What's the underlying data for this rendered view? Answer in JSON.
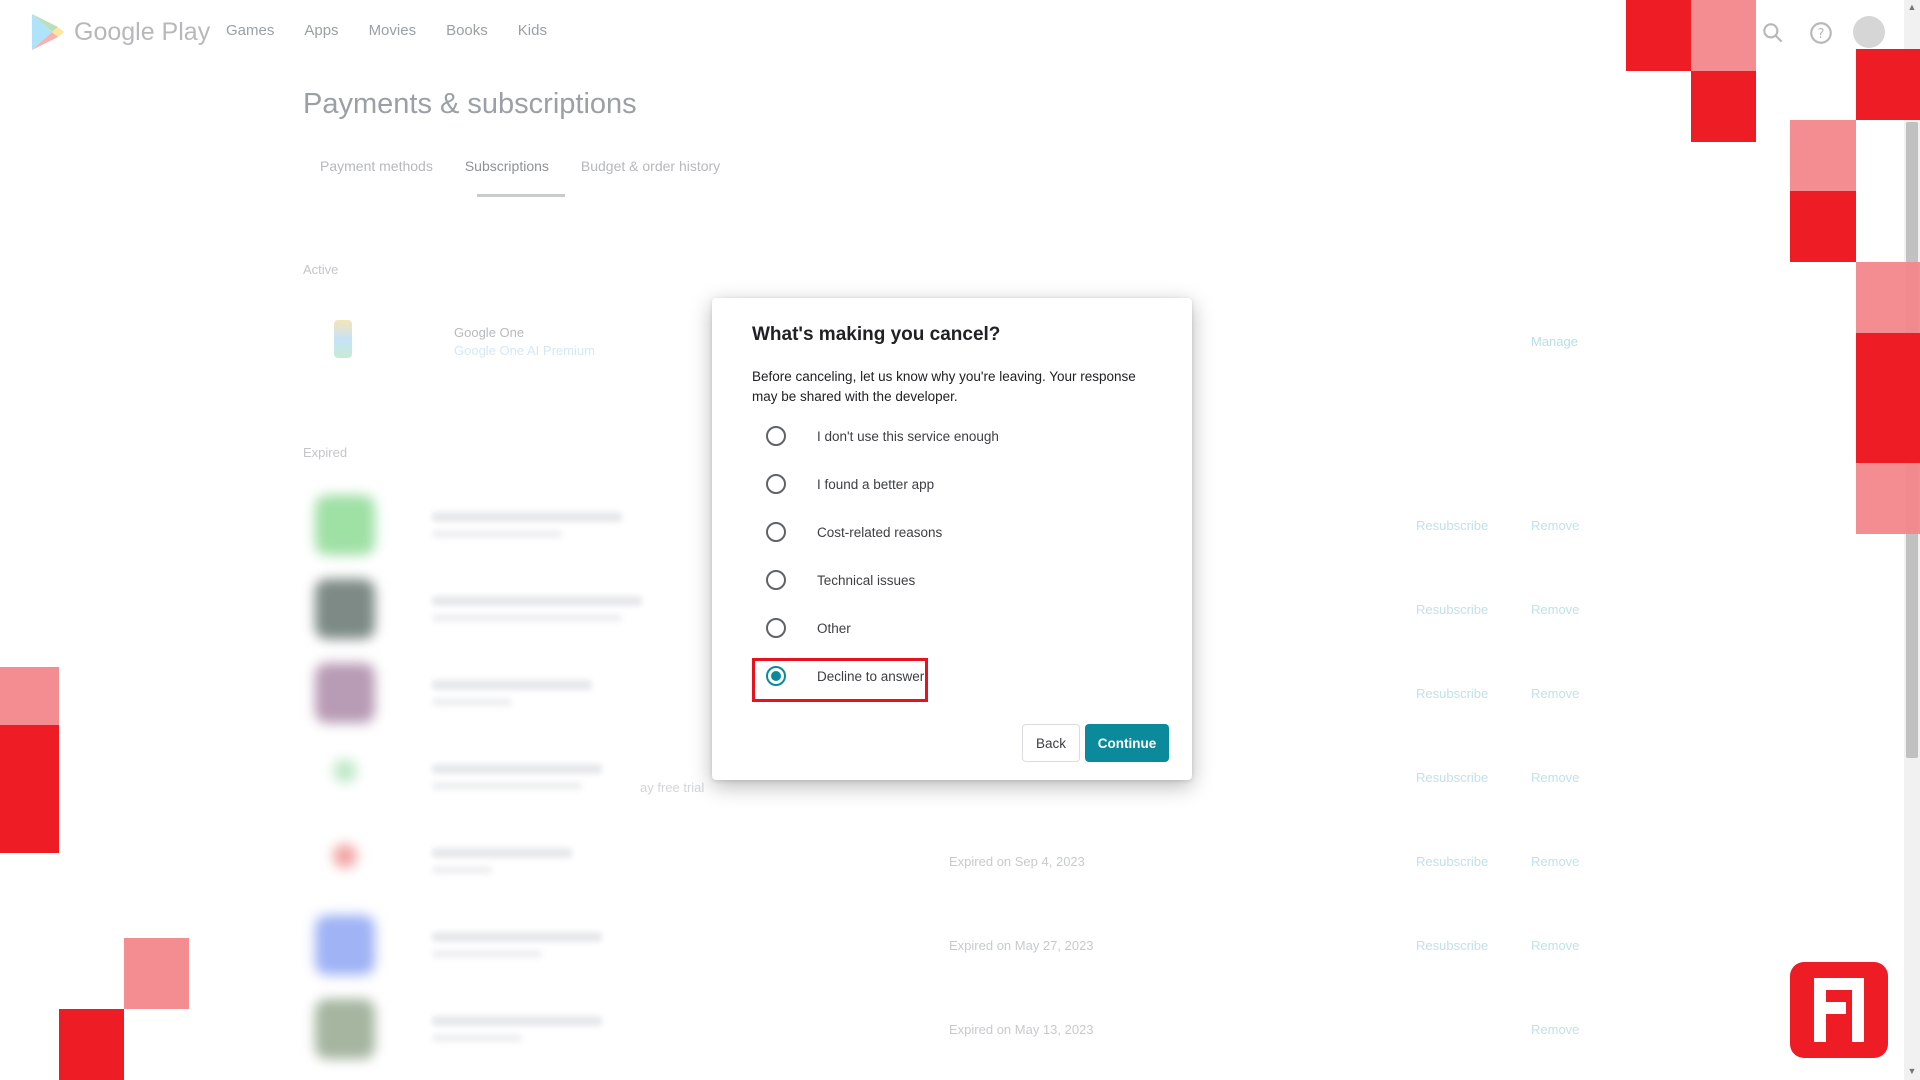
{
  "header": {
    "brand": "Google Play",
    "nav": [
      "Games",
      "Apps",
      "Movies",
      "Books",
      "Kids"
    ],
    "icons": [
      "search-icon",
      "help-icon",
      "avatar"
    ]
  },
  "page": {
    "title": "Payments & subscriptions",
    "tabs": [
      "Payment methods",
      "Subscriptions",
      "Budget & order history"
    ],
    "active_tab": "Subscriptions",
    "active_label": "Active",
    "active_item": {
      "name": "Google One",
      "plan": "Google One AI Premium",
      "action": "Manage"
    },
    "expired_label": "Expired",
    "expired_items": [
      {
        "date": "",
        "resubscribe": "Resubscribe",
        "remove": "Remove"
      },
      {
        "date": "",
        "resubscribe": "Resubscribe",
        "remove": "Remove"
      },
      {
        "date": "",
        "resubscribe": "Resubscribe",
        "remove": "Remove"
      },
      {
        "date": "",
        "resubscribe": "Resubscribe",
        "remove": "Remove"
      },
      {
        "date": "Expired on Sep 4, 2023",
        "resubscribe": "Resubscribe",
        "remove": "Remove"
      },
      {
        "date": "Expired on May 27, 2023",
        "resubscribe": "Resubscribe",
        "remove": "Remove"
      },
      {
        "date": "Expired on May 13, 2023",
        "resubscribe": "",
        "remove": "Remove"
      }
    ],
    "trial_fragment": "ay free trial"
  },
  "dialog": {
    "title": "What's making you cancel?",
    "description": "Before canceling, let us know why you're leaving. Your response may be shared with the developer.",
    "options": [
      {
        "label": "I don't use this service enough",
        "selected": false
      },
      {
        "label": "I found a better app",
        "selected": false
      },
      {
        "label": "Cost-related reasons",
        "selected": false
      },
      {
        "label": "Technical issues",
        "selected": false
      },
      {
        "label": "Other",
        "selected": false
      },
      {
        "label": "Decline to answer",
        "selected": true
      }
    ],
    "back_label": "Back",
    "continue_label": "Continue"
  },
  "colors": {
    "accent": "#0a8a9a",
    "highlight": "#e8121e",
    "overlay_dark": "#ee1c25",
    "overlay_light": "#f3878b"
  }
}
